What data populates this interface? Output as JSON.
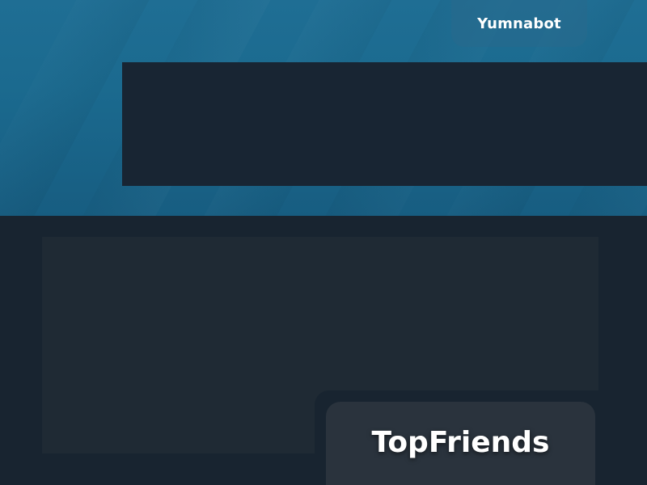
{
  "header": {
    "brand": "Yumnabot"
  },
  "card": {
    "title": "TopFriends"
  },
  "colors": {
    "hero": "#1b6a8f",
    "page_background": "#182430",
    "banner": "#182533",
    "panel": "#1f2a34",
    "card": "#2a333d",
    "text": "#ffffff"
  }
}
